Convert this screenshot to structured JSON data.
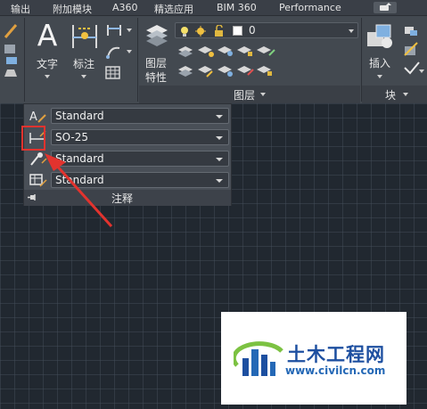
{
  "tabs": [
    "输出",
    "附加模块",
    "A360",
    "精选应用",
    "BIM 360",
    "Performance"
  ],
  "ribbon": {
    "text_label": "文字",
    "dim_label": "标注",
    "layer_props_label_line1": "图层",
    "layer_props_label_line2": "特性",
    "layer_current": "0",
    "layer_panel_title": "图层",
    "insert_label": "插入",
    "block_panel_title": "块"
  },
  "annotation_panel": {
    "text_style": "Standard",
    "dim_style": "SO-25",
    "leader_style": "Standard",
    "table_style": "Standard",
    "title": "注释"
  },
  "watermark": {
    "title": "土木工程网",
    "url": "www.civilcn.com"
  },
  "colors": {
    "highlight": "#e2332e",
    "canvas": "#212830",
    "ribbon": "#434950"
  }
}
